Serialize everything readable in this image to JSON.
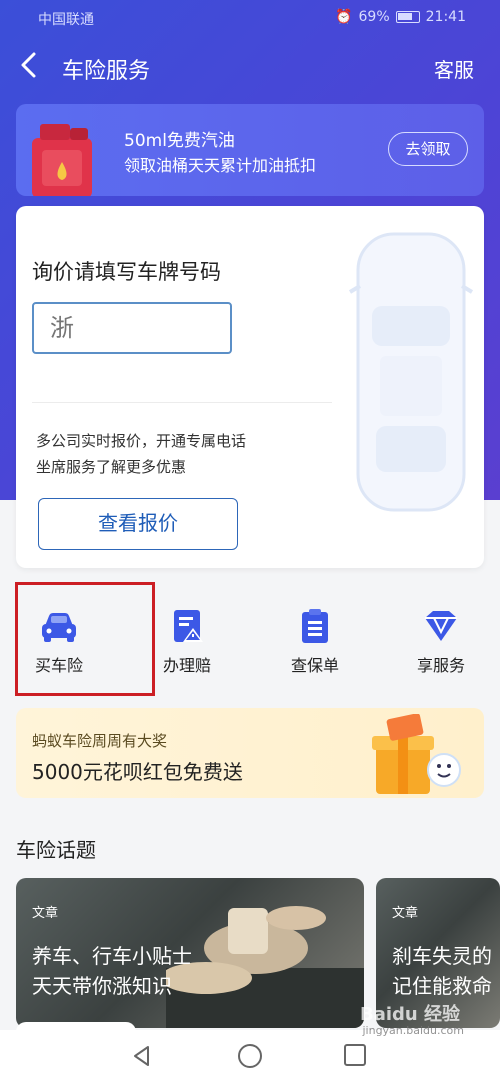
{
  "status_bar": {
    "carrier": "中国联通",
    "battery": "69%",
    "time": "21:41"
  },
  "header": {
    "title": "车险服务",
    "service_label": "客服"
  },
  "oil_banner": {
    "line1": "50ml免费汽油",
    "line2": "领取油桶天天累计加油抵扣",
    "button_label": "去领取"
  },
  "quote_card": {
    "heading": "询价请填写车牌号码",
    "plate_placeholder": "浙",
    "desc_line1": "多公司实时报价，开通专属电话",
    "desc_line2": "坐席服务了解更多优惠",
    "button_label": "查看报价"
  },
  "quick_menu": {
    "items": [
      {
        "label": "买车险",
        "icon": "car-icon"
      },
      {
        "label": "办理赔",
        "icon": "claim-icon"
      },
      {
        "label": "查保单",
        "icon": "policy-icon"
      },
      {
        "label": "享服务",
        "icon": "diamond-icon"
      }
    ]
  },
  "promo_banner": {
    "line1": "蚂蚁车险周周有大奖",
    "line2": "5000元花呗红包免费送"
  },
  "section": {
    "title": "车险话题"
  },
  "articles": [
    {
      "tag": "文章",
      "line1": "养车、行车小贴士",
      "line2": "天天带你涨知识"
    },
    {
      "tag": "文章",
      "line1": "刹车失灵的",
      "line2": "记住能救命"
    }
  ],
  "watermark": {
    "text": "Baidu 经验",
    "sub": "jingyan.baidu.com"
  },
  "colors": {
    "brand": "#3b4fd8",
    "accent": "#1f5db8",
    "highlight": "#cc1f24"
  }
}
